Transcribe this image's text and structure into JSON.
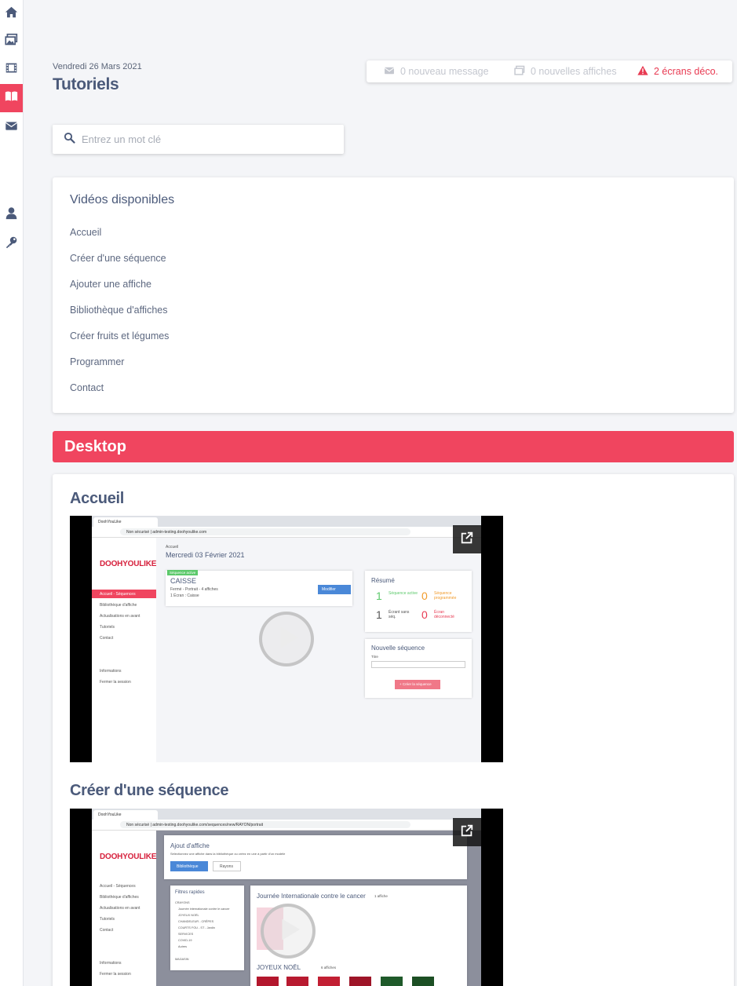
{
  "sidebar": {
    "items": [
      {
        "icon": "home-icon"
      },
      {
        "icon": "images-icon"
      },
      {
        "icon": "film-icon"
      },
      {
        "icon": "book-icon",
        "active": true
      },
      {
        "icon": "envelope-icon"
      },
      {
        "icon": "user-icon"
      },
      {
        "icon": "key-icon"
      }
    ],
    "accent": "#f0455f"
  },
  "header": {
    "date": "Vendredi 26 Mars 2021",
    "title": "Tutoriels"
  },
  "notifications": {
    "messages": "0 nouveau message",
    "posters": "0 nouvelles affiches",
    "screens": "2 écrans déco."
  },
  "search": {
    "placeholder": "Entrez un mot clé"
  },
  "videos": {
    "title": "Vidéos disponibles",
    "links": [
      "Accueil",
      "Créer d'une séquence",
      "Ajouter une affiche",
      "Bibliothèque d'affiches",
      "Créer fruits et légumes",
      "Programmer",
      "Contact"
    ]
  },
  "section": {
    "title": "Desktop"
  },
  "tutorials": [
    {
      "heading": "Accueil",
      "preview": {
        "tab": "DoohYouLike",
        "url": "Non sécurisé  |  admin-testing.doohyoulike.com",
        "logo": "DOOHYOULIKE",
        "menu": [
          "Accueil - Séquences",
          "Bibliothèque d'affiche",
          "Actualisations en avant",
          "Tutoriels",
          "Contact"
        ],
        "menu_bottom": [
          "Informations",
          "Fermer la session"
        ],
        "page_label": "Accueil",
        "page_date": "Mercredi 03 Février 2021",
        "badge": "Séquence active",
        "seq_title": "CAISSE",
        "seq_line1": "Fermé - Portrait - 4 affiches",
        "seq_line2": "1 Écran : Caisse",
        "edit_btn": "Modifier",
        "summary_title": "Résumé",
        "stat1_num": "1",
        "stat1_label": "Séquence active",
        "stat2_num": "0",
        "stat2_label": "Séquence programmée",
        "stat3_num": "1",
        "stat3_label": "Écrant sans séq.",
        "stat4_num": "0",
        "stat4_label": "Écran déconnecté",
        "new_seq_title": "Nouvelle séquence",
        "new_seq_label": "Titre",
        "create_btn": "+ Créer la séquence"
      }
    },
    {
      "heading": "Créer d'une séquence",
      "preview": {
        "tab": "DoohYouLike",
        "url": "Non sécurisé  |  admin-testing.doohyoulike.com/sequences/new/RAYON/portrait",
        "logo": "DOOHYOULIKE",
        "menu": [
          "Accueil - Séquences",
          "Bibliothèque d'affiches",
          "Actualisations en avant",
          "Tutoriels",
          "Contact"
        ],
        "menu_bottom": [
          "Informations",
          "Fermer la session"
        ],
        "modal_title": "Ajout d'affiche",
        "modal_desc": "Sélectionnez une affiche dans la bibliothèque ou créez en une à partir d'un modèle",
        "btn_library": "Bibliothèque",
        "btn_rayon": "Rayons",
        "filters_title": "Filtres rapides",
        "filters": [
          "CRAYONS",
          "Journée internationale contre le cancer",
          "JOYEUX NOËL",
          "CHANDELEUR - CRÊPES",
          "COURTS FOU - ST - Jardin",
          "SERVICES",
          "COVID-19",
          "Autres",
          "MAGASIN"
        ],
        "list_title": "Journée Internationale contre le cancer",
        "list_count": "1 affiche",
        "list2_title": "JOYEUX NOËL",
        "list2_count": "6 affiches"
      }
    }
  ]
}
